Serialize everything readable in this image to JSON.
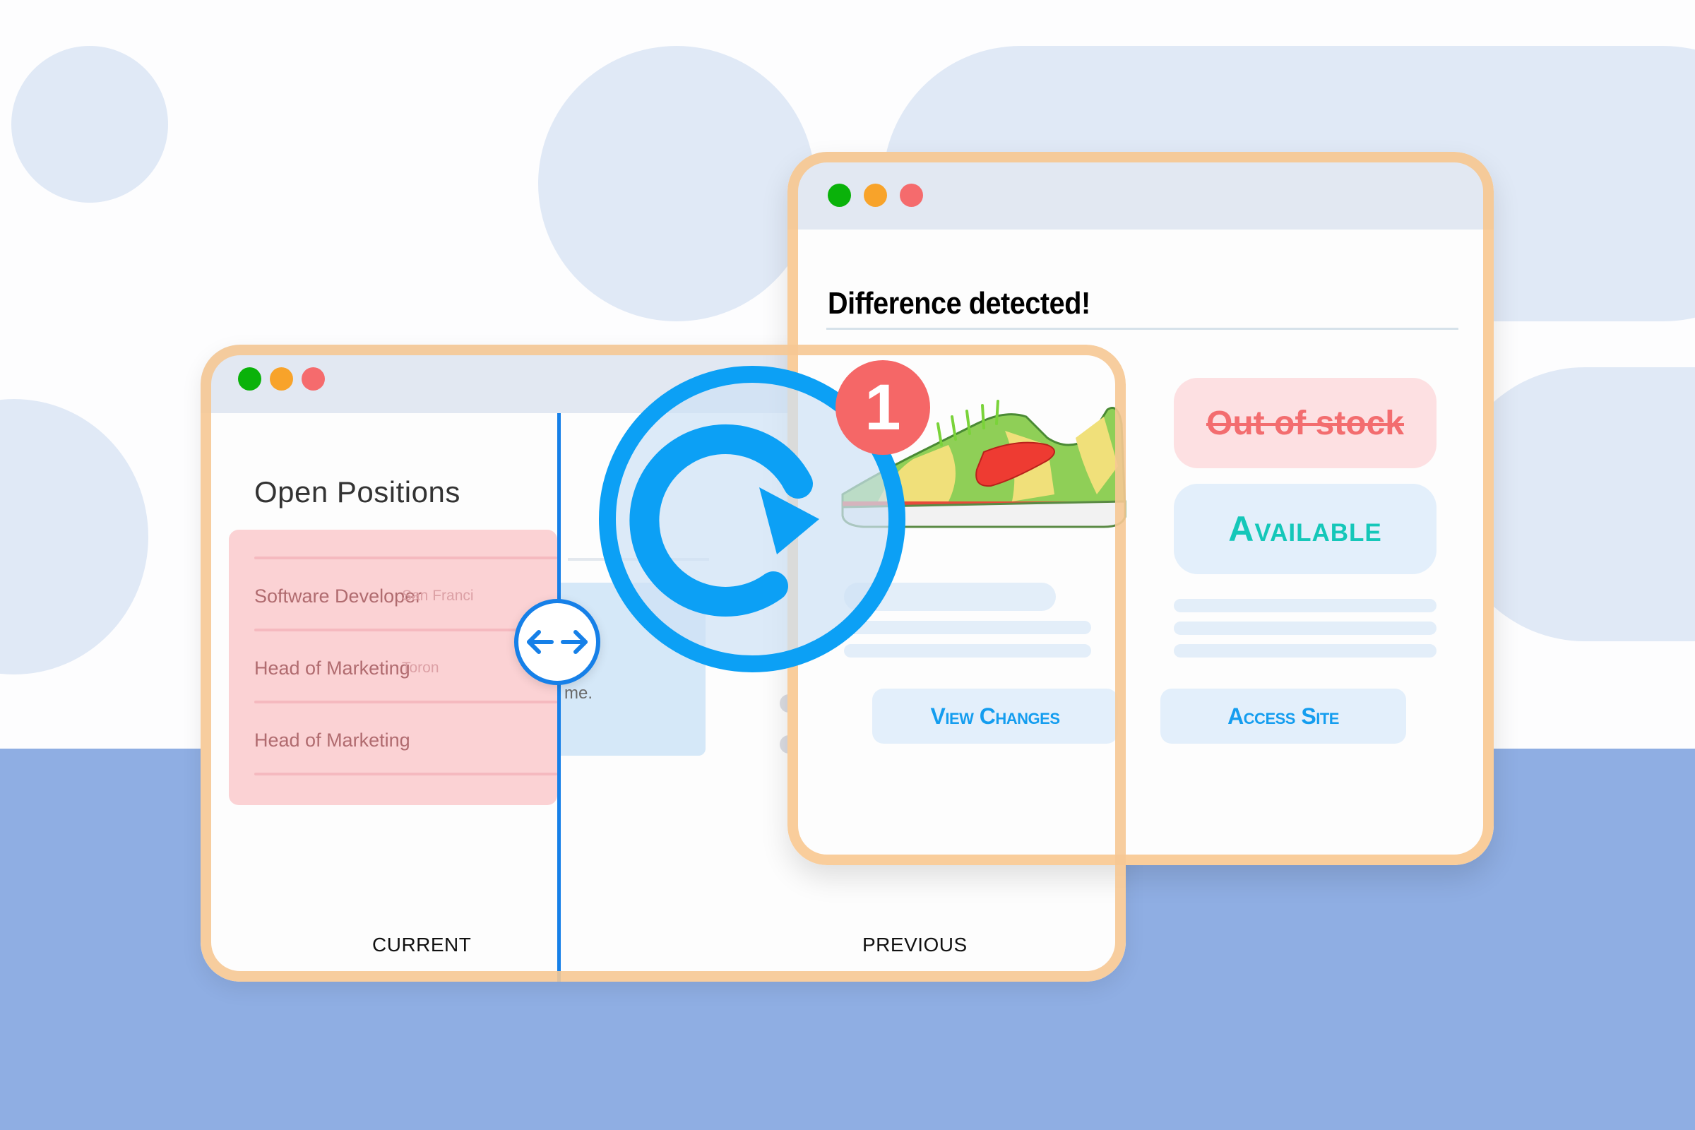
{
  "left_window": {
    "title": "Open Positions",
    "positions": [
      {
        "role": "Software Developer",
        "location": "San Franci"
      },
      {
        "role": "Head of Marketing",
        "location": "Toron"
      },
      {
        "role": "Head of Marketing",
        "location": ""
      }
    ],
    "previous_snippet": "me.",
    "current_label": "CURRENT",
    "previous_label": "PREVIOUS"
  },
  "right_window": {
    "title": "Difference detected!",
    "old_status": "Out of stock",
    "new_status": "Available",
    "buttons": {
      "view_changes": "View Changes",
      "access_site": "Access Site"
    }
  },
  "badge": {
    "count": "1"
  },
  "icons": {
    "compare_slider": "double-arrow-icon",
    "refresh": "refresh-icon",
    "product": "sneaker-image"
  },
  "colors": {
    "accent_blue": "#1680e8",
    "refresh_blue": "#0ca0f5",
    "badge_red": "#f56767",
    "available_teal": "#15c7b9",
    "out_of_stock_red": "#f36d6f",
    "frame_orange": "#f8c48a",
    "band_blue": "#8faee3"
  }
}
